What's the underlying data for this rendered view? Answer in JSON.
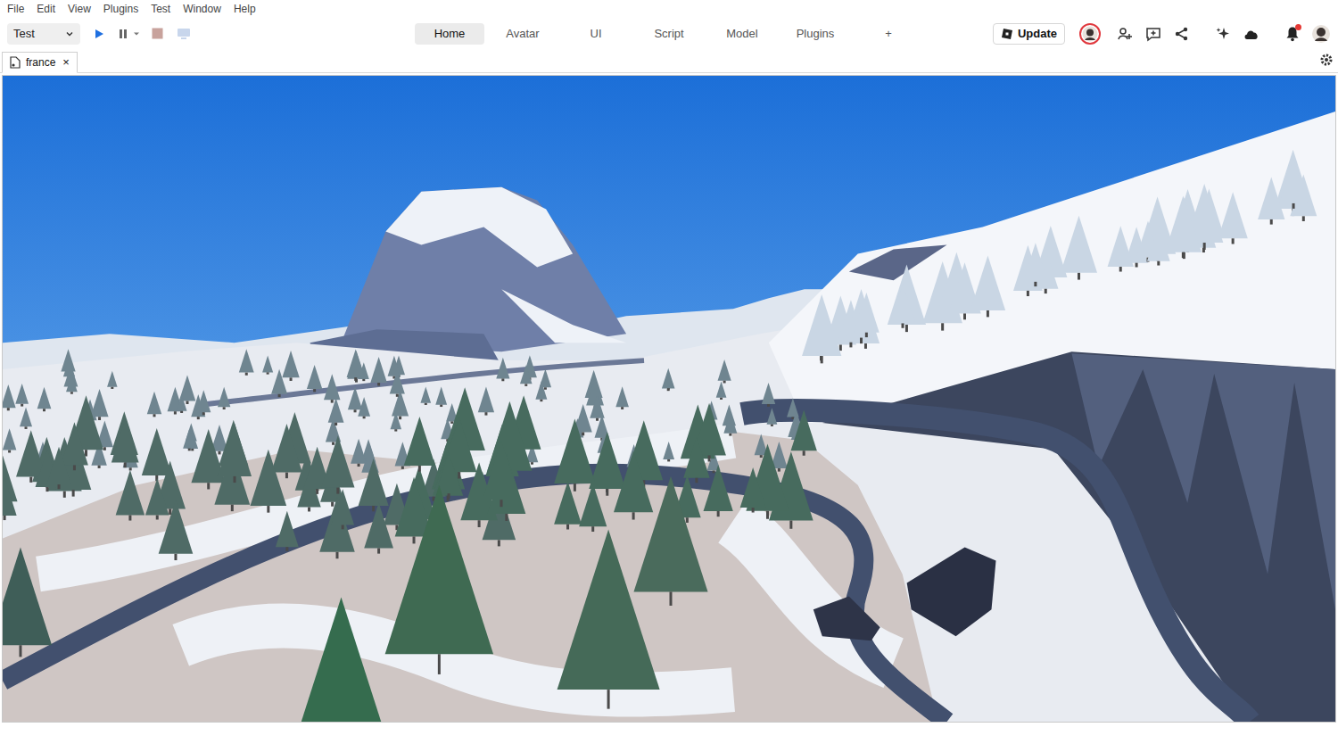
{
  "menu": [
    "File",
    "Edit",
    "View",
    "Plugins",
    "Test",
    "Window",
    "Help"
  ],
  "mode_select": {
    "value": "Test"
  },
  "ribbon_tabs": [
    {
      "label": "Home",
      "selected": true
    },
    {
      "label": "Avatar",
      "selected": false
    },
    {
      "label": "UI",
      "selected": false
    },
    {
      "label": "Script",
      "selected": false
    },
    {
      "label": "Model",
      "selected": false
    },
    {
      "label": "Plugins",
      "selected": false
    }
  ],
  "add_tab": "+",
  "update_button": {
    "label": "Update"
  },
  "notifications": {
    "unread": true
  },
  "document_tabs": [
    {
      "label": "france",
      "close": "×",
      "selected": true
    }
  ]
}
